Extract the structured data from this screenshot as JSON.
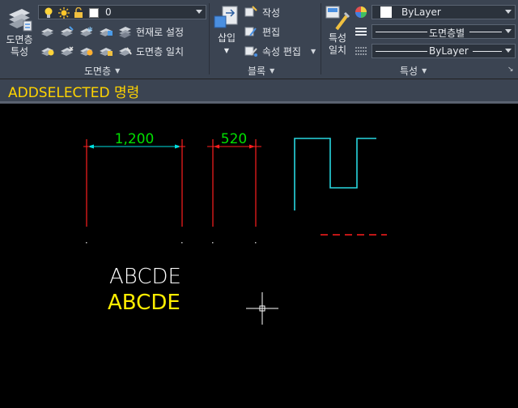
{
  "layer_panel": {
    "manager_label_1": "도면층",
    "manager_label_2": "특성",
    "layer_combo_value": "0",
    "set_current_label": "현재로 설정",
    "match_layer_label": "도면층 일치",
    "title": "도면층"
  },
  "block_panel": {
    "insert_label": "삽입",
    "create_label": "작성",
    "edit_label": "편집",
    "edit_attributes_label": "속성 편집",
    "title": "블록"
  },
  "properties_panel": {
    "match_label_1": "특성",
    "match_label_2": "일치",
    "color_value": "ByLayer",
    "linetype_value": "도면층별",
    "lineweight_value": "ByLayer",
    "title": "특성"
  },
  "command_line": {
    "text": "ADDSELECTED 명령"
  },
  "drawing": {
    "dimension_1": "1,200",
    "dimension_2": "520",
    "text_white": "ABCDE",
    "text_yellow": "ABCDE"
  },
  "colors": {
    "ribbon_bg": "#3b4452",
    "canvas_bg": "#000000",
    "command_text": "#ffd400",
    "dim_text": "#00e000",
    "dim_line": "#00e0e0",
    "red_lines": "#ff1e1e",
    "cyan_polyline": "#28d7e0",
    "yellow_text": "#ffee00",
    "white_text": "#ffffff"
  }
}
